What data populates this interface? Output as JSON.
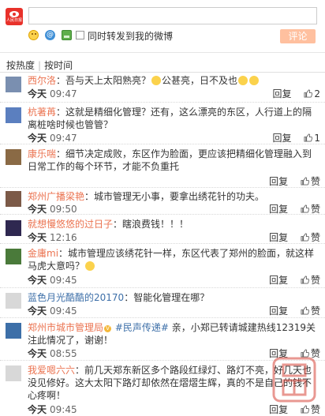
{
  "composer": {
    "logo_text": "人民日报",
    "forward_label": "同时转发到我的微博",
    "comment_button": "评论",
    "forward_checked": false
  },
  "sort": {
    "by_hot": "按热度",
    "separator": "|",
    "by_time": "按时间"
  },
  "reply_label": "回复",
  "like_label": "赞",
  "comments": [
    {
      "user": "西尔洛",
      "pre": "：吾与天上太阳熟亮？",
      "mid": "公甚亮，日不及也",
      "post": "",
      "day": "今天",
      "time": "09:47",
      "likes": "2",
      "avatar_color": "#7a8fb0"
    },
    {
      "user": "杭著苒",
      "text": "：这就是精细化管理？还有，这么漂亮的东区，人行道上的隔离桩啥时候也管管？",
      "day": "今天",
      "time": "09:47",
      "likes": "1",
      "avatar_color": "#5b7fbf"
    },
    {
      "user": "康乐喘",
      "text": "：细节决定成败，东区作为脸面，更应该把精细化管理融入到日常工作的每个环节，才能不负重托",
      "day": "今天",
      "time": "09:56",
      "likes": "赞",
      "avatar_color": "#8a6a45"
    },
    {
      "user": "郑州广播梁艳",
      "text": "：城市管理无小事，要拿出绣花针的功夫。",
      "day": "今天",
      "time": "09:50",
      "likes": "赞",
      "avatar_color": "#7c5a48"
    },
    {
      "user": "就想慢悠悠的过日子",
      "text": "：瞎浪费钱！！！",
      "day": "今天",
      "time": "12:16",
      "likes": "赞",
      "avatar_color": "#2f2850"
    },
    {
      "user": "金庸mi",
      "pre": "：城市管理应该绣花针一样，东区代表了郑州的脸面，就这样马虎大意吗？",
      "day": "今天",
      "time": "09:45",
      "likes": "赞",
      "avatar_color": "#4a7a3a"
    },
    {
      "user": "蓝色月光酷酷的20170",
      "text": "：智能化管理在哪？",
      "day": "今天",
      "time": "09:45",
      "likes": "赞",
      "avatar_color": "#d8d8d8"
    },
    {
      "user": "郑州市城市管理局",
      "vip": "V",
      "topic": "#民声传递#",
      "text": " 亲，小郑已转请城建热线12319关注此情况了，谢谢！",
      "day": "今天",
      "time": "08:55",
      "likes": "赞",
      "avatar_color": "#3d6fa8"
    },
    {
      "user": "我爱嗯六六",
      "text": "：前几天郑东新区多个路段红绿灯、路灯不亮，好几天也没见修好。这大太阳下路灯却依然在熠熠生辉，真的不是自己的钱不心疼啊！",
      "day": "今天",
      "time": "09:45",
      "likes": "赞",
      "avatar_color": "#d8d8d8"
    }
  ]
}
